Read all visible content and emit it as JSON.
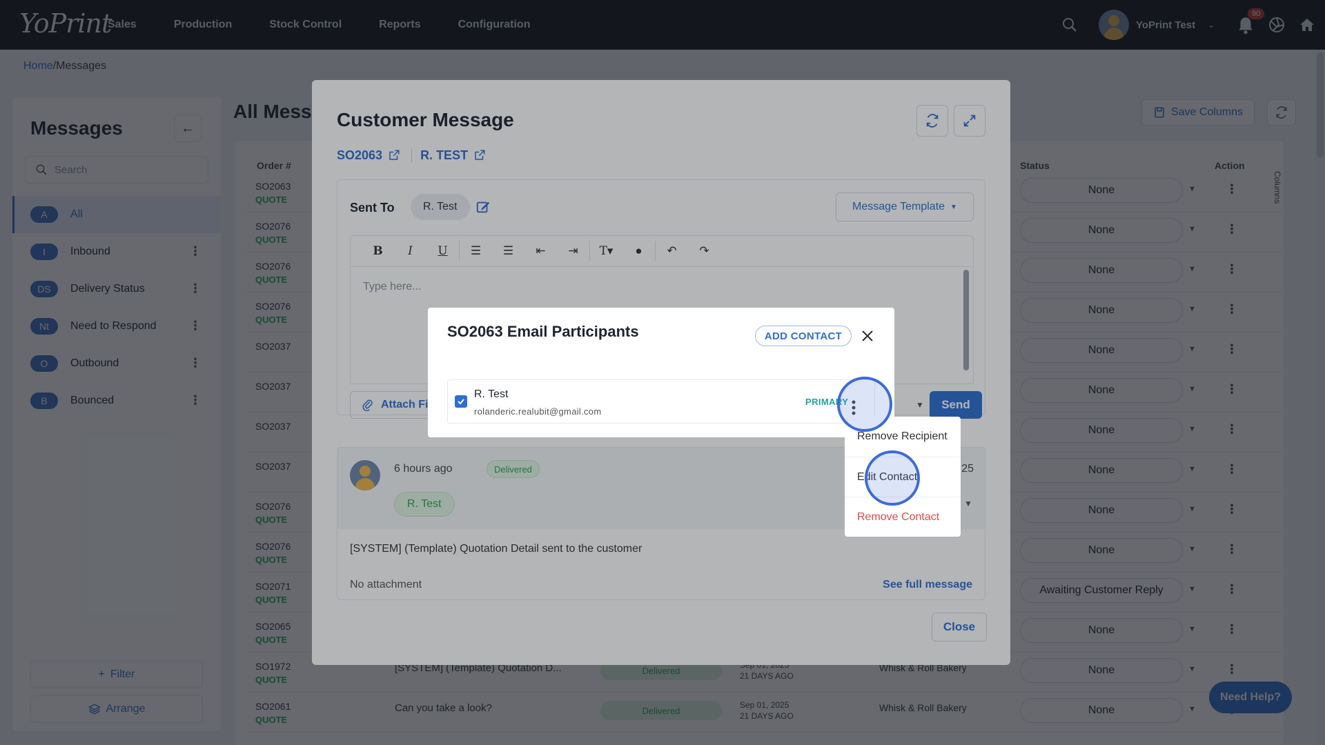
{
  "app": {
    "logo": "YoPrint",
    "nav": [
      "Sales",
      "Production",
      "Stock Control",
      "Reports",
      "Configuration"
    ],
    "user_name": "YoPrint Test",
    "notification_count": "90",
    "icons": {
      "search": "search-icon",
      "bell": "bell-icon",
      "aperture": "aperture-icon",
      "home": "home-icon"
    }
  },
  "breadcrumb": {
    "home": "Home",
    "sep": "/",
    "current": "Messages"
  },
  "sidebar": {
    "title": "Messages",
    "search_placeholder": "Search",
    "items": [
      {
        "badge": "A",
        "label": "All",
        "active": true
      },
      {
        "badge": "I",
        "label": "Inbound"
      },
      {
        "badge": "DS",
        "label": "Delivery Status"
      },
      {
        "badge": "Nt",
        "label": "Need to Respond"
      },
      {
        "badge": "O",
        "label": "Outbound"
      },
      {
        "badge": "B",
        "label": "Bounced"
      }
    ],
    "filter_label": "Filter",
    "arrange_label": "Arrange"
  },
  "main": {
    "title": "All Messages",
    "save_columns_label": "Save Columns",
    "columns_tab": "Columns",
    "headers": {
      "order": "Order #",
      "status": "Status",
      "action": "Action"
    },
    "rows": [
      {
        "order": "SO2063",
        "type": "QUOTE",
        "status": "None"
      },
      {
        "order": "SO2076",
        "type": "QUOTE",
        "status": "None"
      },
      {
        "order": "SO2076",
        "type": "QUOTE",
        "status": "None"
      },
      {
        "order": "SO2076",
        "type": "QUOTE",
        "status": "None"
      },
      {
        "order": "SO2037",
        "type": "",
        "status": "None"
      },
      {
        "order": "SO2037",
        "type": "",
        "status": "None"
      },
      {
        "order": "SO2037",
        "type": "",
        "status": "None"
      },
      {
        "order": "SO2037",
        "type": "",
        "status": "None"
      },
      {
        "order": "SO2076",
        "type": "QUOTE",
        "status": "None"
      },
      {
        "order": "SO2076",
        "type": "QUOTE",
        "status": "None"
      },
      {
        "order": "SO2071",
        "type": "QUOTE",
        "status": "Awaiting Customer Reply"
      },
      {
        "order": "SO2065",
        "type": "QUOTE",
        "status": "None"
      },
      {
        "order": "SO1972",
        "type": "QUOTE",
        "subject": "[SYSTEM] (Template) Quotation D...",
        "delivery": "Delivered",
        "date": "Sep 01, 2025",
        "ago": "21 DAYS AGO",
        "customer": "Whisk & Roll Bakery",
        "status": "None"
      },
      {
        "order": "SO2061",
        "type": "QUOTE",
        "subject": "Can you take a look?",
        "delivery": "Delivered",
        "date": "Sep 01, 2025",
        "ago": "21 DAYS AGO",
        "customer": "Whisk & Roll Bakery",
        "status": "None"
      }
    ],
    "need_help": "Need Help?"
  },
  "customer_message": {
    "title": "Customer Message",
    "order_link": "SO2063",
    "contact_link": "R. TEST",
    "sent_to_label": "Sent To",
    "sent_to_chip": "R. Test",
    "template_label": "Message Template",
    "toolbar": [
      "B",
      "I",
      "U",
      "ordered-list",
      "bullet-list",
      "outdent",
      "indent",
      "text-size",
      "color",
      "undo",
      "redo"
    ],
    "editor_placeholder": "Type here...",
    "attach_label": "Attach Files",
    "send_label": "Send",
    "message": {
      "time": "6 hours ago",
      "status": "Delivered",
      "recipient": "R. Test",
      "date_fragment": "25",
      "body": "[SYSTEM] (Template) Quotation Detail sent to the customer",
      "attachment": "No attachment",
      "see_full": "See full message"
    },
    "close_label": "Close"
  },
  "participants": {
    "title": "SO2063 Email Participants",
    "add_contact": "ADD CONTACT",
    "contact": {
      "name": "R. Test",
      "email": "rolanderic.realubit@gmail.com",
      "tag": "PRIMARY",
      "checked": true
    }
  },
  "context_menu": {
    "items": [
      "Remove Recipient",
      "Edit Contact",
      "Remove Contact"
    ]
  }
}
